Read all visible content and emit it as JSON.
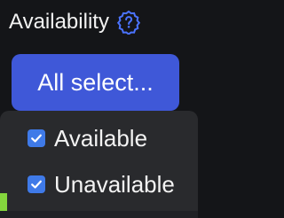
{
  "filter": {
    "title": "Availability",
    "select_label": "All select...",
    "options": [
      {
        "label": "Available",
        "checked": true
      },
      {
        "label": "Unavailable",
        "checked": true
      }
    ]
  },
  "icons": {
    "help": "question-mark-badge-icon",
    "check": "check-icon"
  },
  "colors": {
    "background": "#141518",
    "dropdown_background": "#292a2d",
    "button": "#3f58d8",
    "checkbox": "#3f7ae8",
    "accent": "#84d63d",
    "text": "#f2f2f2"
  }
}
